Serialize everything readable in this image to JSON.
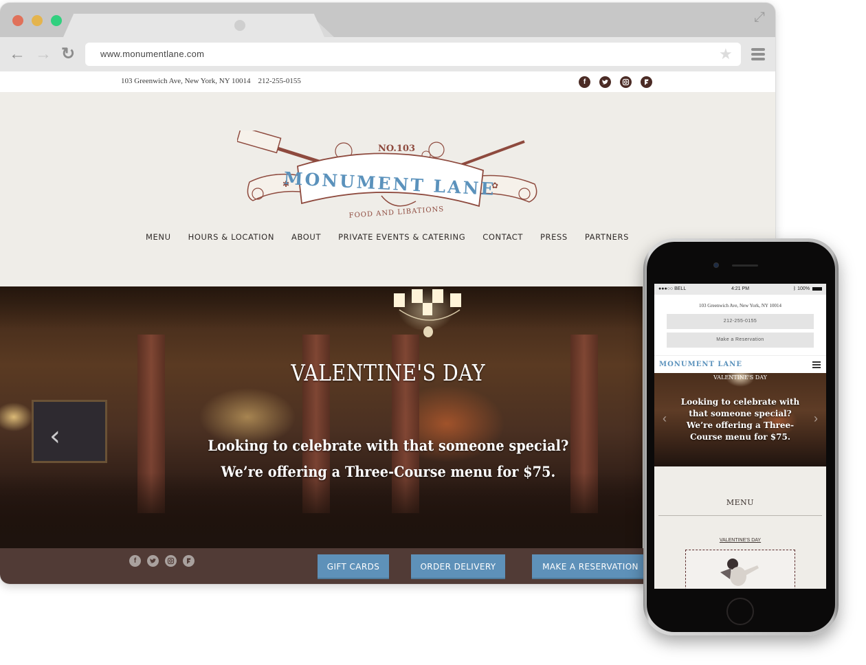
{
  "browser": {
    "url": "www.monumentlane.com",
    "icons": {
      "back": "arrow-left-icon",
      "forward": "arrow-right-icon",
      "reload": "reload-icon",
      "bookmark": "star-icon",
      "menu": "hamburger-icon",
      "expand": "expand-icon"
    }
  },
  "site": {
    "infobar": {
      "address": "103 Greenwich Ave, New York, NY 10014",
      "phone": "212-255-0155",
      "social": [
        {
          "name": "facebook-icon",
          "glyph": "f"
        },
        {
          "name": "twitter-icon",
          "glyph": "t"
        },
        {
          "name": "instagram-icon",
          "glyph": "◎"
        },
        {
          "name": "foursquare-icon",
          "glyph": "F"
        }
      ]
    },
    "logo": {
      "number": "NO.103",
      "name": "MONUMENT LANE",
      "tagline": "FOOD AND LIBATIONS"
    },
    "nav": [
      {
        "label": "MENU"
      },
      {
        "label": "HOURS & LOCATION"
      },
      {
        "label": "ABOUT"
      },
      {
        "label": "PRIVATE EVENTS & CATERING"
      },
      {
        "label": "CONTACT"
      },
      {
        "label": "PRESS"
      },
      {
        "label": "PARTNERS"
      }
    ],
    "hero": {
      "title": "VALENTINE'S DAY",
      "line1": "Looking to celebrate with that someone special?",
      "line2": "We’re offering a Three-Course menu for $75.",
      "prev_glyph": "‹"
    },
    "footer": {
      "gift_cards": "GIFT CARDS",
      "order_delivery": "ORDER DELIVERY",
      "make_reservation": "MAKE A RESERVATION"
    },
    "colors": {
      "brand_blue": "#5e91b9",
      "brand_brown": "#513b36",
      "logo_red": "#8e4a3e",
      "background": "#efede8"
    }
  },
  "phone": {
    "status": {
      "carrier": "●●●○○ BELL",
      "time": "4:21 PM",
      "battery": "100%"
    },
    "address": "103 Greenwich Ave, New York, NY 10014",
    "phone_button": "212-255-0155",
    "reserve_button": "Make a Reservation",
    "logo": "MONUMENT LANE",
    "hero": {
      "title": "VALENTINE'S DAY",
      "text": "Looking to celebrate with that someone special? We’re offering a Three-Course menu for $75."
    },
    "menu_title": "MENU",
    "menu_link": "VALENTINE'S DAY"
  }
}
